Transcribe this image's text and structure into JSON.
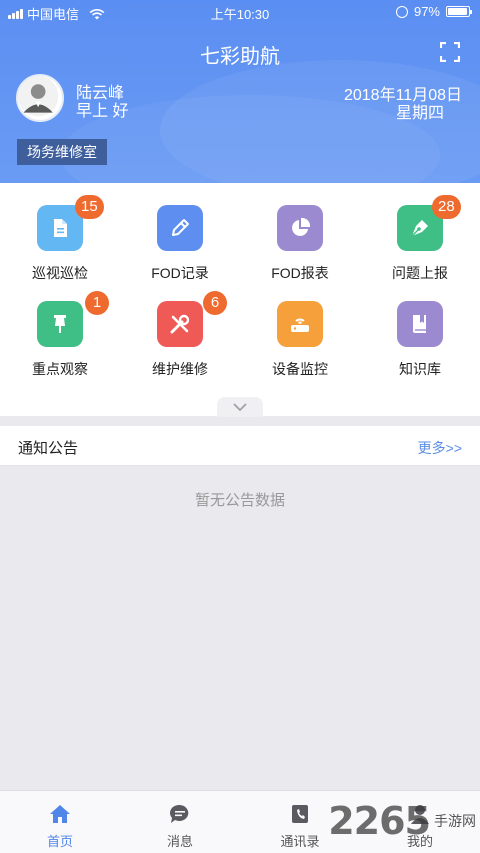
{
  "status_bar": {
    "carrier": "中国电信",
    "time": "上午10:30",
    "battery": "97%",
    "battery_level": 0.97
  },
  "header": {
    "title": "七彩助航",
    "user_name": "陆云峰",
    "greeting": "早上 好",
    "date": "2018年11月08日",
    "weekday": "星期四",
    "department": "场务维修室"
  },
  "grid": [
    {
      "label": "巡视巡检",
      "badge": "15",
      "icon": "document-icon",
      "color": "#63b8f4"
    },
    {
      "label": "FOD记录",
      "badge": "",
      "icon": "pencil-icon",
      "color": "#5e8ff0"
    },
    {
      "label": "FOD报表",
      "badge": "",
      "icon": "pie-chart-icon",
      "color": "#9b8ad0"
    },
    {
      "label": "问题上报",
      "badge": "28",
      "icon": "pen-nib-icon",
      "color": "#3fbe86"
    },
    {
      "label": "重点观察",
      "badge": "1",
      "icon": "pushpin-icon",
      "color": "#3fbe86"
    },
    {
      "label": "维护维修",
      "badge": "6",
      "icon": "tools-icon",
      "color": "#ef5a57"
    },
    {
      "label": "设备监控",
      "badge": "",
      "icon": "router-icon",
      "color": "#f5a03a"
    },
    {
      "label": "知识库",
      "badge": "",
      "icon": "book-icon",
      "color": "#9b8ad0"
    }
  ],
  "notice": {
    "title": "通知公告",
    "more": "更多>>",
    "empty": "暂无公告数据"
  },
  "tabbar": [
    {
      "label": "首页",
      "icon": "home-icon",
      "active": true
    },
    {
      "label": "消息",
      "icon": "chat-icon",
      "active": false
    },
    {
      "label": "通讯录",
      "icon": "contacts-icon",
      "active": false
    },
    {
      "label": "我的",
      "icon": "profile-icon",
      "active": false
    }
  ],
  "watermark": {
    "number": "2265",
    "site": "手游网"
  },
  "colors": {
    "header": "#5b8ef2",
    "badge": "#ef6a2e",
    "active_tab": "#4f86e8"
  }
}
